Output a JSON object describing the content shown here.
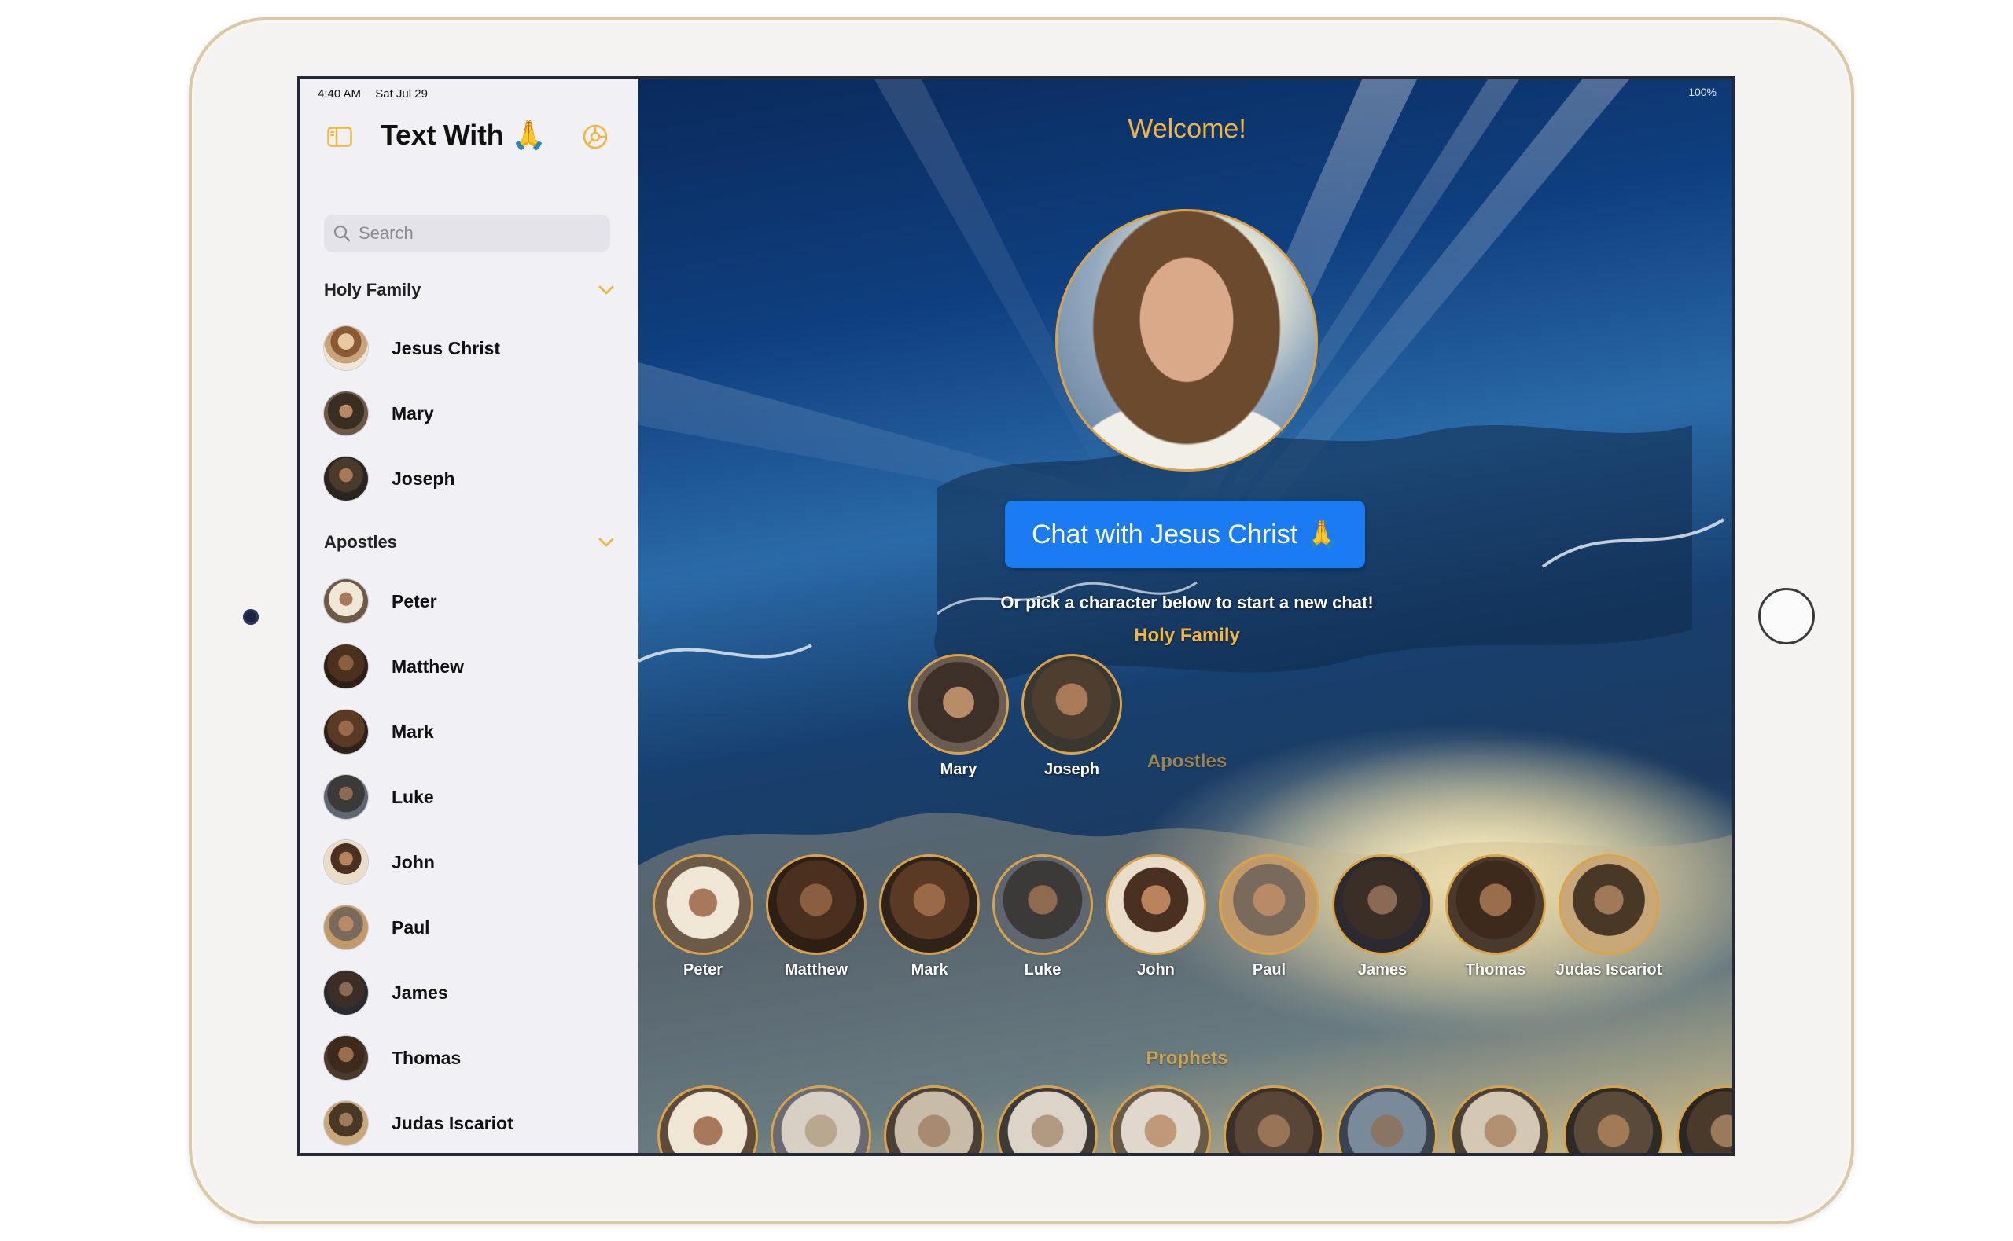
{
  "status_bar": {
    "time": "4:40 AM",
    "date": "Sat Jul 29",
    "battery": "100%"
  },
  "app": {
    "title": "Text With 🙏"
  },
  "search": {
    "placeholder": "Search"
  },
  "sidebar": {
    "sections": [
      {
        "title": "Holy Family",
        "items": [
          "Jesus Christ",
          "Mary",
          "Joseph"
        ]
      },
      {
        "title": "Apostles",
        "items": [
          "Peter",
          "Matthew",
          "Mark",
          "Luke",
          "John",
          "Paul",
          "James",
          "Thomas",
          "Judas Iscariot"
        ]
      }
    ]
  },
  "main": {
    "welcome": "Welcome!",
    "chat_button": "Chat with Jesus Christ 🙏",
    "pick_text": "Or pick a character below to start a new chat!",
    "holy_family_title": "Holy Family",
    "holy_family": [
      "Mary",
      "Joseph"
    ],
    "apostles_title": "Apostles",
    "apostles": [
      "Peter",
      "Matthew",
      "Mark",
      "Luke",
      "John",
      "Paul",
      "James",
      "Thomas",
      "Judas Iscariot"
    ],
    "prophets_title": "Prophets"
  },
  "colors": {
    "accent": "#f2b640",
    "button_blue": "#1a7bf2",
    "sidebar_bg": "#f1f0f5"
  },
  "icons": [
    "sidebar-toggle-icon",
    "settings-icon",
    "search-icon",
    "chevron-down-icon"
  ]
}
